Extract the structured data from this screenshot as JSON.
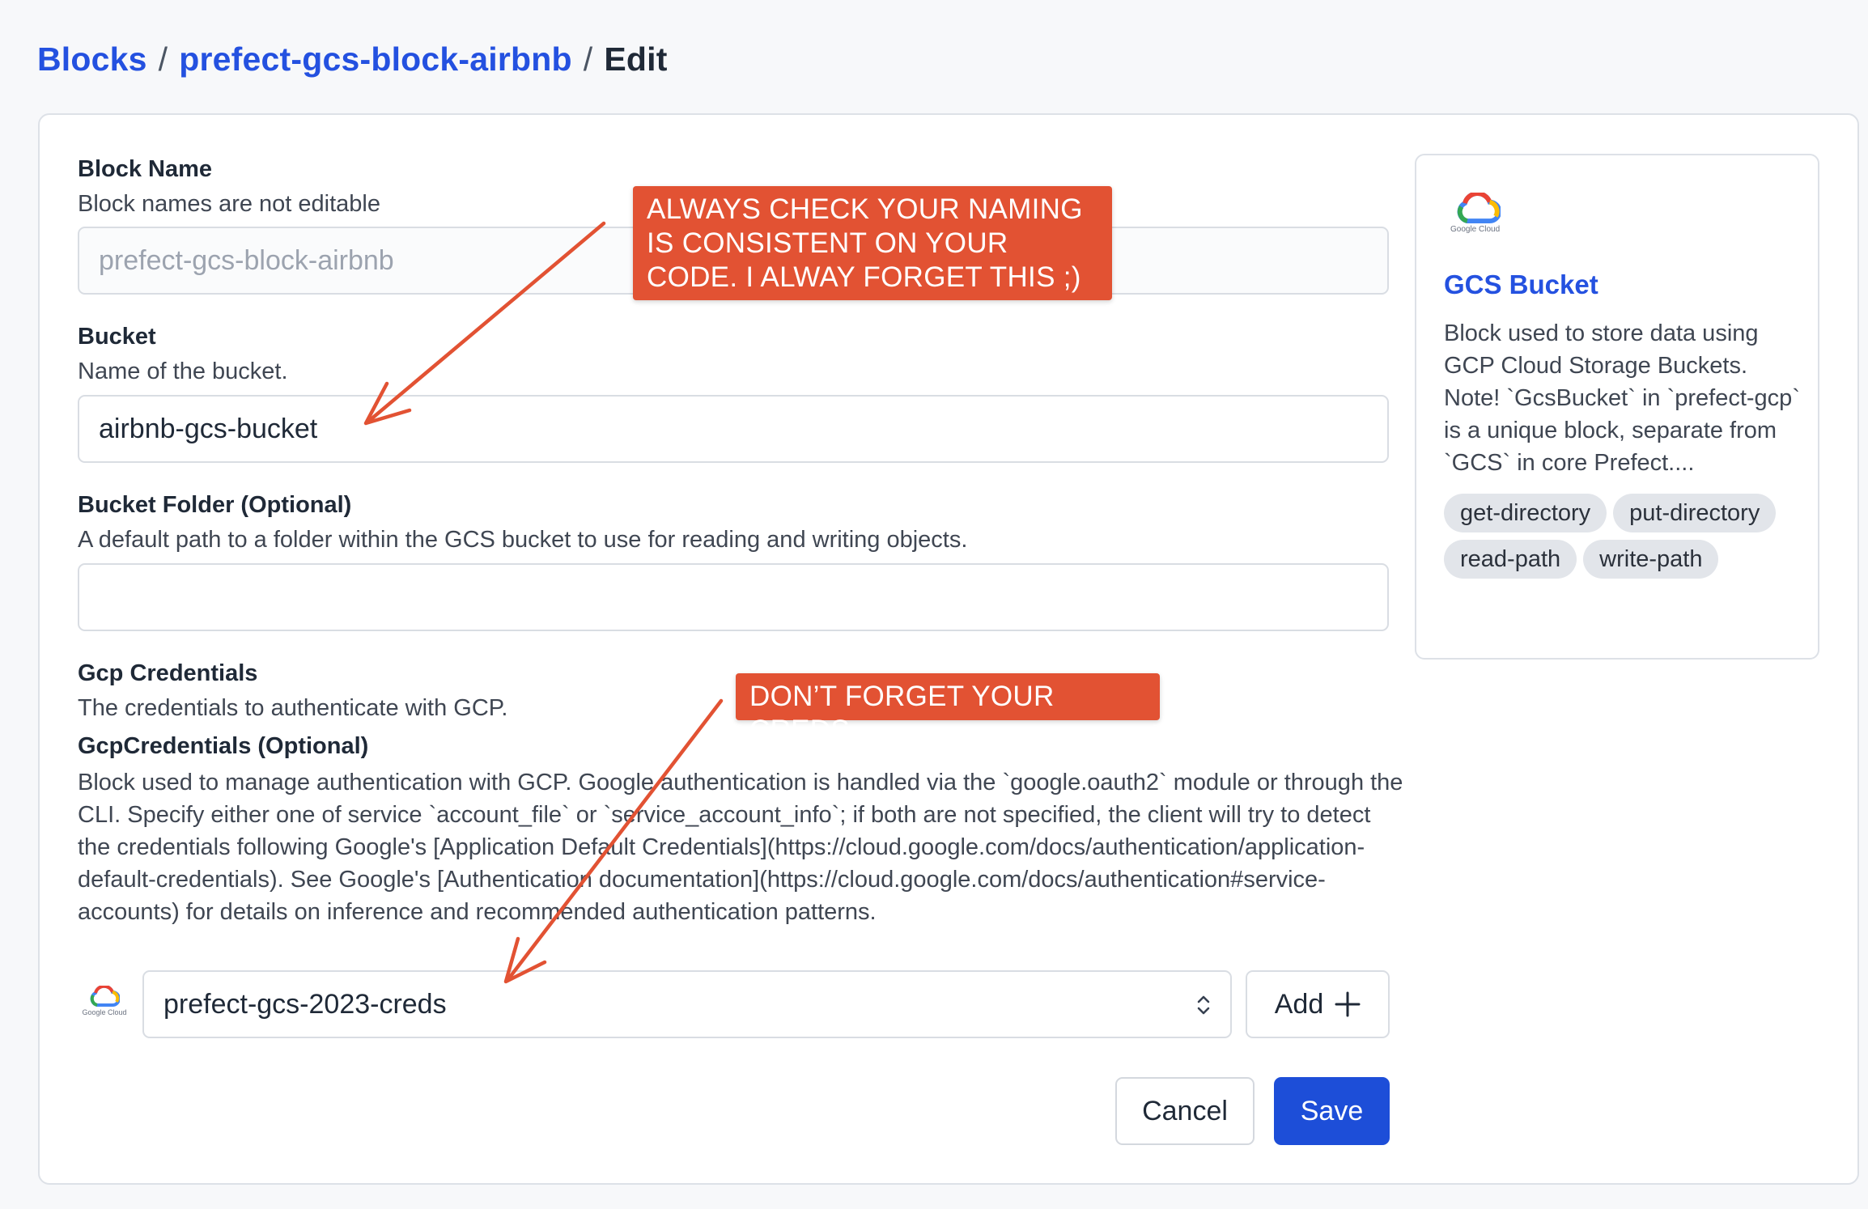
{
  "breadcrumb": {
    "root": "Blocks",
    "sep1": "/",
    "block": "prefect-gcs-block-airbnb",
    "sep2": "/",
    "current": "Edit"
  },
  "form": {
    "block_name": {
      "title": "Block Name",
      "desc": "Block names are not editable",
      "value": "prefect-gcs-block-airbnb"
    },
    "bucket": {
      "title": "Bucket",
      "desc": "Name of the bucket.",
      "value": "airbnb-gcs-bucket"
    },
    "bucket_folder": {
      "title": "Bucket Folder (Optional)",
      "desc": "A default path to a folder within the GCS bucket to use for reading and writing objects.",
      "value": ""
    },
    "gcp_credentials": {
      "title": "Gcp Credentials",
      "desc": "The credentials to authenticate with GCP.",
      "sub_title": "GcpCredentials (Optional)",
      "long_desc": "Block used to manage authentication with GCP. Google authentication is handled via the `google.oauth2` module or through the CLI. Specify either one of service `account_file` or `service_account_info`; if both are not specified, the client will try to detect the credentials following Google's [Application Default Credentials](https://cloud.google.com/docs/authentication/application-default-credentials). See Google's [Authentication documentation](https://cloud.google.com/docs/authentication#service-accounts) for details on inference and recommended authentication patterns.",
      "selected": "prefect-gcs-2023-creds",
      "add_label": "Add",
      "logo_text": "Google Cloud"
    },
    "cancel_label": "Cancel",
    "save_label": "Save"
  },
  "side": {
    "logo_text": "Google Cloud",
    "title": "GCS Bucket",
    "desc": "Block used to store data using GCP Cloud Storage Buckets. Note! `GcsBucket` in `prefect-gcp` is a unique block, separate from `GCS` in core Prefect....",
    "chips": [
      "get-directory",
      "put-directory",
      "read-path",
      "write-path"
    ]
  },
  "annotations": {
    "note1": "ALWAYS CHECK YOUR NAMING IS CONSISTENT ON YOUR CODE. I ALWAY FORGET THIS ;)",
    "note2": "DON’T FORGET YOUR CREDS"
  },
  "colors": {
    "link": "#2451e0",
    "primary": "#1d4ed8",
    "annotation": "#e25233"
  }
}
